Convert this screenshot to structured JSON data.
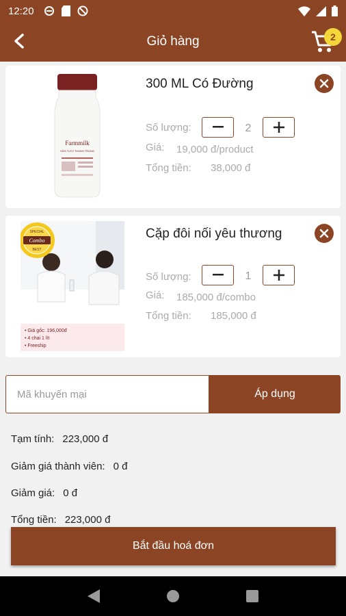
{
  "status_bar": {
    "time": "12:20"
  },
  "app_bar": {
    "title": "Giỏ hàng",
    "cart_count": "2"
  },
  "cart_items": [
    {
      "name": "300 ML Có Đường",
      "qty_label": "Số lượng:",
      "qty": "2",
      "price_label": "Giá:",
      "price": "19,000 đ/product",
      "total_label": "Tổng tiền:",
      "total": "38,000 đ",
      "bottle_brand": "Farmmilk",
      "bottle_text": "SỮA TƯƠI THANH TRÙNG"
    },
    {
      "name": "Cặp đôi nối yêu thương",
      "qty_label": "Số lượng:",
      "qty": "1",
      "price_label": "Giá:",
      "price": "185,000 đ/combo",
      "total_label": "Tổng tiền:",
      "total": "185,000 đ",
      "badge_top": "SPECIAL",
      "badge_mid": "Combo",
      "badge_bottom": "BEST",
      "combo_notes": [
        "• Giá gốc: 196,000đ",
        "• 4 chai 1 lít",
        "• Freeship"
      ]
    }
  ],
  "promo": {
    "placeholder": "Mã khuyến mại",
    "apply_label": "Áp dụng"
  },
  "summary": {
    "subtotal_label": "Tạm tính:",
    "subtotal": "223,000 đ",
    "member_discount_label": "Giảm giá thành viên:",
    "member_discount": "0 đ",
    "discount_label": "Giảm giá:",
    "discount": "0 đ",
    "total_label": "Tổng tiền:",
    "total": "223,000 đ"
  },
  "checkout_label": "Bắt đầu hoá đơn",
  "colors": {
    "brand": "#8b4524",
    "badge": "#f4d63b"
  }
}
